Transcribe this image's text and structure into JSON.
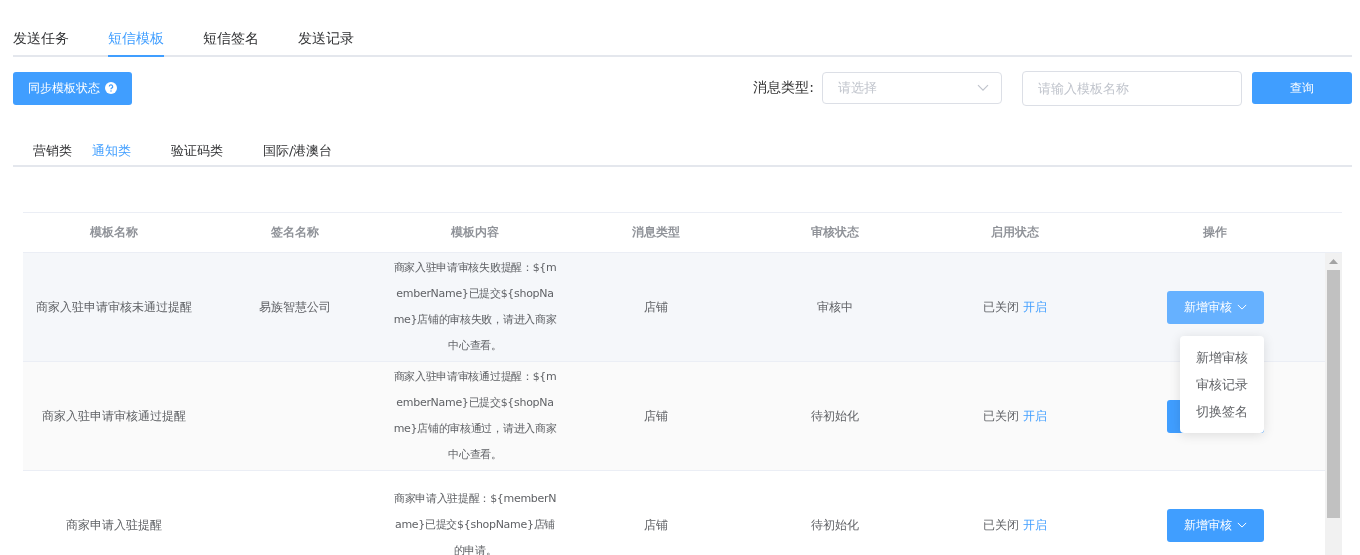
{
  "tabs": [
    {
      "label": "发送任务",
      "selected": false
    },
    {
      "label": "短信模板",
      "selected": true
    },
    {
      "label": "短信签名",
      "selected": false
    },
    {
      "label": "发送记录",
      "selected": false
    }
  ],
  "sync_button": {
    "label": "同步模板状态"
  },
  "filters": {
    "type_label": "消息类型:",
    "type_select": {
      "placeholder": "请选择"
    },
    "name_field": {
      "placeholder": "请输入模板名称"
    },
    "query_button": "查询"
  },
  "sub_tabs": [
    {
      "label": "营销类",
      "selected": false
    },
    {
      "label": "通知类",
      "selected": true
    },
    {
      "label": "验证码类",
      "selected": false
    },
    {
      "label": "国际/港澳台",
      "selected": false
    }
  ],
  "table": {
    "columns": [
      "模板名称",
      "签名名称",
      "模板内容",
      "消息类型",
      "审核状态",
      "启用状态",
      "操作"
    ],
    "rows": [
      {
        "name": "商家入驻申请审核未通过提醒",
        "signature": "易族智慧公司",
        "content": "商家入驻申请审核失败提醒：${memberName}已提交${shopName}店铺的审核失败，请进入商家中心查看。",
        "type": "店铺",
        "review_status": "审核中",
        "enable_status": "已关闭",
        "enable_link": "开启",
        "hovered": true,
        "action": {
          "label": "新增审核",
          "menu_open": true,
          "menu": [
            "新增审核",
            "审核记录",
            "切换签名"
          ]
        }
      },
      {
        "name": "商家入驻申请审核通过提醒",
        "signature": "",
        "content": "商家入驻申请审核通过提醒：${memberName}已提交${shopName}店铺的审核通过，请进入商家中心查看。",
        "type": "店铺",
        "review_status": "待初始化",
        "enable_status": "已关闭",
        "enable_link": "开启",
        "hovered": false,
        "action": {
          "menu_open": false
        }
      },
      {
        "name": "商家申请入驻提醒",
        "signature": "",
        "content": "商家申请入驻提醒：${memberName}已提交${shopName}店铺的申请。",
        "type": "店铺",
        "review_status": "待初始化",
        "enable_status": "已关闭",
        "enable_link": "开启",
        "hovered": false,
        "action": {
          "label": "新增审核",
          "menu_open": false
        }
      }
    ]
  }
}
